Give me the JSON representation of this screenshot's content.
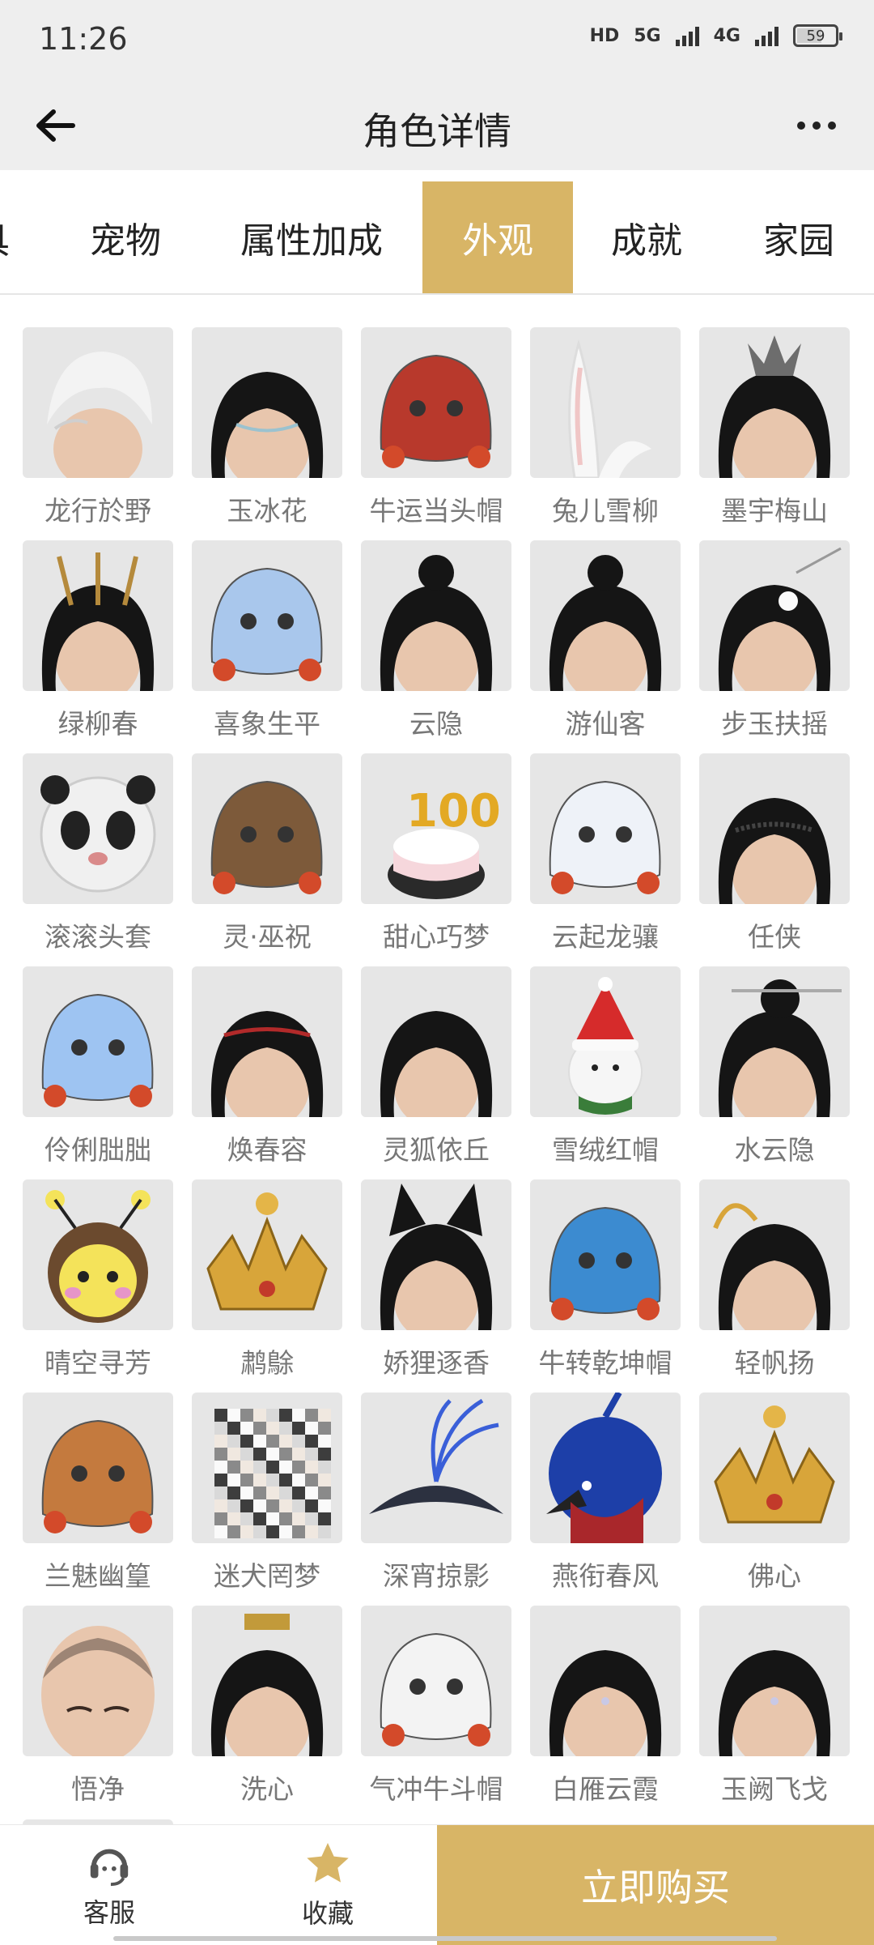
{
  "status": {
    "time": "11:26",
    "signal1": "HD",
    "net1": "5G",
    "net2": "4G",
    "battery": "59",
    "battery_level": 0.59
  },
  "header": {
    "title": "角色详情"
  },
  "tabs": [
    {
      "label": "具",
      "active": false
    },
    {
      "label": "宠物",
      "active": false
    },
    {
      "label": "属性加成",
      "active": false
    },
    {
      "label": "外观",
      "active": true
    },
    {
      "label": "成就",
      "active": false
    },
    {
      "label": "家园",
      "active": false
    }
  ],
  "items": [
    {
      "name": "龙行於野",
      "icon": "white-hair"
    },
    {
      "name": "玉冰花",
      "icon": "black-hair-circlet"
    },
    {
      "name": "牛运当头帽",
      "icon": "red-ox-hat"
    },
    {
      "name": "兔儿雪柳",
      "icon": "rabbit-ear"
    },
    {
      "name": "墨宇梅山",
      "icon": "dark-crown-hair"
    },
    {
      "name": "绿柳春",
      "icon": "antler-crown"
    },
    {
      "name": "喜象生平",
      "icon": "elephant-hat"
    },
    {
      "name": "云隐",
      "icon": "topknot-hair"
    },
    {
      "name": "游仙客",
      "icon": "topknot-hair"
    },
    {
      "name": "步玉扶摇",
      "icon": "flower-hairpin"
    },
    {
      "name": "滚滚头套",
      "icon": "panda-mask"
    },
    {
      "name": "灵·巫祝",
      "icon": "shaman-mask"
    },
    {
      "name": "甜心巧梦",
      "icon": "cake-hat"
    },
    {
      "name": "云起龙骧",
      "icon": "dragon-mask"
    },
    {
      "name": "任侠",
      "icon": "circlet-hair"
    },
    {
      "name": "伶俐朏朏",
      "icon": "blue-creature-hat"
    },
    {
      "name": "焕春容",
      "icon": "headband-hair"
    },
    {
      "name": "灵狐依丘",
      "icon": "long-black-hair"
    },
    {
      "name": "雪绒红帽",
      "icon": "snowman-hat"
    },
    {
      "name": "水云隐",
      "icon": "bun-hairpin"
    },
    {
      "name": "晴空寻芳",
      "icon": "bee-hat"
    },
    {
      "name": "鹔鵌",
      "icon": "gold-phoenix-crown"
    },
    {
      "name": "娇狸逐香",
      "icon": "cat-ear-hair"
    },
    {
      "name": "牛转乾坤帽",
      "icon": "blue-ox-hat"
    },
    {
      "name": "轻帆扬",
      "icon": "wing-hair"
    },
    {
      "name": "兰魅幽篁",
      "icon": "fox-hat"
    },
    {
      "name": "迷犬罔梦",
      "icon": "pixel-dog-mask"
    },
    {
      "name": "深宵掠影",
      "icon": "feather-hat"
    },
    {
      "name": "燕衔春风",
      "icon": "blue-bird-hat"
    },
    {
      "name": "佛心",
      "icon": "golden-buddha-crown"
    },
    {
      "name": "悟净",
      "icon": "shaved-head"
    },
    {
      "name": "洗心",
      "icon": "crowned-braids"
    },
    {
      "name": "气冲牛斗帽",
      "icon": "white-ox-hat"
    },
    {
      "name": "白雁云霞",
      "icon": "forehead-jewel-hair"
    },
    {
      "name": "玉阙飞戈",
      "icon": "forehead-jewel-hair"
    }
  ],
  "bottom": {
    "service_label": "客服",
    "favorite_label": "收藏",
    "buy_label": "立即购买"
  },
  "colors": {
    "accent": "#d8b566",
    "header_bg": "#eeeeee",
    "thumb_bg": "#e6e6e6",
    "label": "#777777"
  }
}
